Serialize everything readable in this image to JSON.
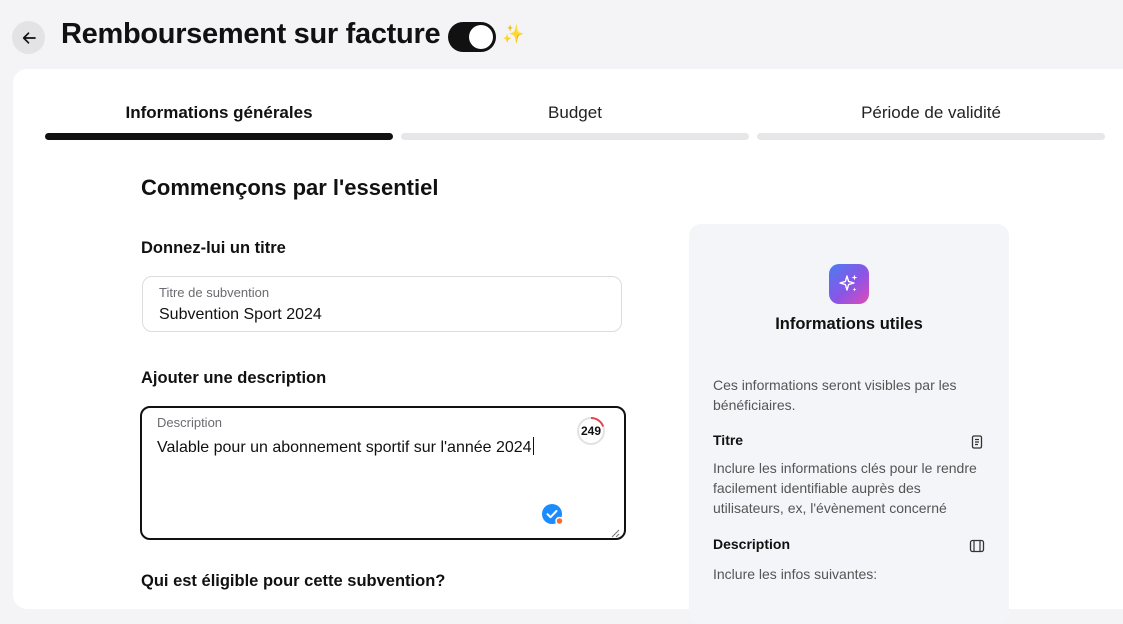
{
  "header": {
    "title": "Remboursement sur facture",
    "toggle_on": true,
    "sparkle": "✨"
  },
  "tabs": [
    {
      "label": "Informations générales",
      "active": true
    },
    {
      "label": "Budget",
      "active": false
    },
    {
      "label": "Période de validité",
      "active": false
    }
  ],
  "form": {
    "section_title": "Commençons par l'essentiel",
    "title_heading": "Donnez-lui un titre",
    "title_field": {
      "label": "Titre de subvention",
      "value": "Subvention Sport 2024"
    },
    "description_heading": "Ajouter une description",
    "description_field": {
      "label": "Description",
      "value": "Valable pour un abonnement sportif sur l'année 2024",
      "remaining_chars": "249"
    },
    "eligibility_heading": "Qui est éligible pour cette subvention?"
  },
  "help_panel": {
    "icon": "sparkles-icon",
    "title": "Informations utiles",
    "intro": "Ces informations seront visibles par les bénéficiaires.",
    "items": [
      {
        "title": "Titre",
        "icon": "document-icon",
        "text": "Inclure les informations clés pour le rendre facilement identifiable auprès des utilisateurs, ex, l'évènement concerné"
      },
      {
        "title": "Description",
        "icon": "book-icon",
        "text": "Inclure les infos suivantes:"
      }
    ]
  },
  "colors": {
    "page_bg": "#f4f4f6",
    "card_bg": "#ffffff",
    "active_tab": "#111111",
    "inactive_tab": "#e7e7ea",
    "check_badge": "#1a8cff",
    "counter_ring": "#e5484d"
  }
}
